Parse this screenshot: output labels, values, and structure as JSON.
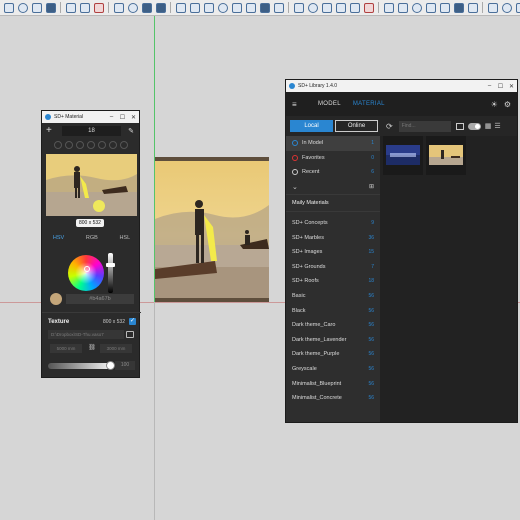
{
  "toolbar": {
    "icon_count": 40
  },
  "material": {
    "title": "SD+ Material",
    "min_symbol": "–",
    "max_symbol": "☐",
    "close_symbol": "✕",
    "add_symbol": "+",
    "number_value": "18",
    "size_badge": "800 x 532",
    "modes": [
      "HSV",
      "RGB",
      "HSL"
    ],
    "hex_value": "#b4a67b",
    "texture_label": "Texture",
    "texture_size": "800 x 532",
    "texture_path": "D:\\Dropbox\\SD-Thu.vaso7",
    "width_value": "5000 mm",
    "height_value": "3000 mm",
    "opacity_value": "100",
    "opacity_fraction": 0.95,
    "swatch_color": "#c4a67a"
  },
  "library": {
    "title": "SD+ Library 1.4.0",
    "tabs": {
      "model": "MODEL",
      "material": "MATERIAL"
    },
    "segments": {
      "local": "Local",
      "online": "Online"
    },
    "find_placeholder": "Find...",
    "categories": [
      {
        "label": "In Model",
        "count": "1"
      },
      {
        "label": "Favorites",
        "count": "0"
      },
      {
        "label": "Recent",
        "count": "6"
      }
    ],
    "my_list_label": "Maily Materials",
    "materials": [
      {
        "label": "SD+ Concepts",
        "count": "9"
      },
      {
        "label": "SD+ Marbles",
        "count": "36"
      },
      {
        "label": "SD+ Images",
        "count": "15"
      },
      {
        "label": "SD+ Grounds",
        "count": "7"
      },
      {
        "label": "SD+ Roofs",
        "count": "18"
      },
      {
        "label": "Basic",
        "count": "56"
      },
      {
        "label": "Black",
        "count": "56"
      },
      {
        "label": "Dark theme_Caro",
        "count": "56"
      },
      {
        "label": "Dark theme_Lavender",
        "count": "56"
      },
      {
        "label": "Dark theme_Purple",
        "count": "56"
      },
      {
        "label": "Greyscale",
        "count": "56"
      },
      {
        "label": "Minimalist_Blueprint",
        "count": "56"
      },
      {
        "label": "Minimalist_Concrete",
        "count": "56"
      }
    ]
  },
  "colors": {
    "accent": "#2a86d1",
    "axis_green": "#55c46a",
    "axis_red": "#c98a8a"
  }
}
